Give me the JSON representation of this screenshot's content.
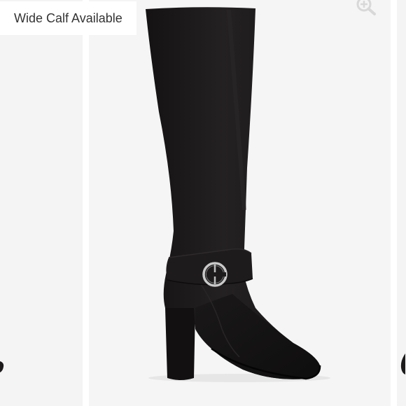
{
  "badge": {
    "label": "Wide Calf Available"
  },
  "zoom": {
    "icon": "zoom-in-icon"
  },
  "product_image": {
    "subject": "boot-image"
  },
  "colors": {
    "background": "#f5f5f5",
    "boot": "#1c1a1b",
    "buckle": "#c9c9c9",
    "badge_text": "#333333",
    "icon": "#d8d8d8"
  }
}
